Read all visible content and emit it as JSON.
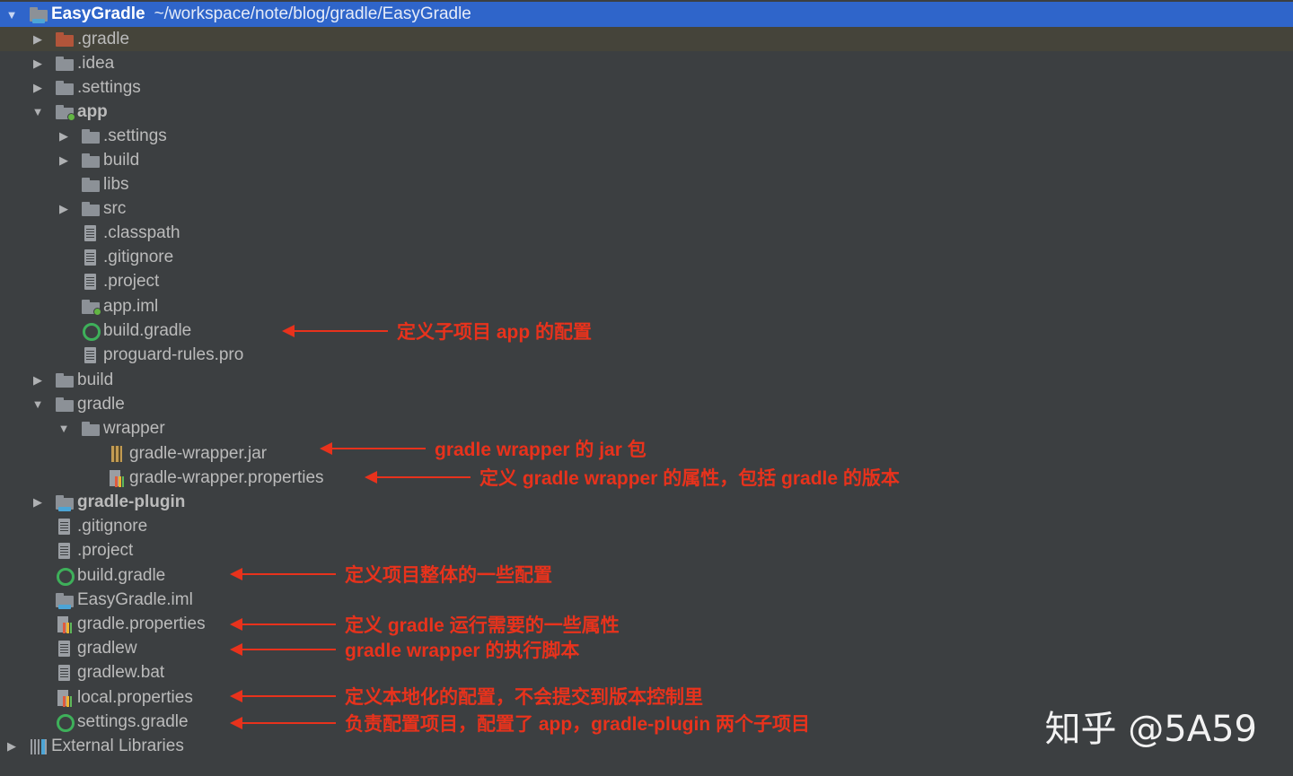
{
  "project": {
    "name": "EasyGradle",
    "path": "~/workspace/note/blog/gradle/EasyGradle"
  },
  "tree": [
    {
      "label": ".gradle",
      "icon": "orange-folder-icon"
    },
    {
      "label": ".idea",
      "icon": "folder-icon"
    },
    {
      "label": ".settings",
      "icon": "folder-icon"
    },
    {
      "label": "app",
      "icon": "module-folder-icon"
    },
    {
      "label": ".settings",
      "icon": "folder-icon"
    },
    {
      "label": "build",
      "icon": "folder-icon"
    },
    {
      "label": "libs",
      "icon": "folder-icon"
    },
    {
      "label": "src",
      "icon": "folder-icon"
    },
    {
      "label": ".classpath",
      "icon": "text-file-icon"
    },
    {
      "label": ".gitignore",
      "icon": "text-file-icon"
    },
    {
      "label": ".project",
      "icon": "text-file-icon"
    },
    {
      "label": "app.iml",
      "icon": "module-file-icon"
    },
    {
      "label": "build.gradle",
      "icon": "gradle-icon"
    },
    {
      "label": "proguard-rules.pro",
      "icon": "text-file-icon"
    },
    {
      "label": "build",
      "icon": "folder-icon"
    },
    {
      "label": "gradle",
      "icon": "folder-icon"
    },
    {
      "label": "wrapper",
      "icon": "folder-icon"
    },
    {
      "label": "gradle-wrapper.jar",
      "icon": "jar-icon"
    },
    {
      "label": "gradle-wrapper.properties",
      "icon": "properties-icon"
    },
    {
      "label": "gradle-plugin",
      "icon": "module-folder-icon"
    },
    {
      "label": ".gitignore",
      "icon": "text-file-icon"
    },
    {
      "label": ".project",
      "icon": "text-file-icon"
    },
    {
      "label": "build.gradle",
      "icon": "gradle-icon"
    },
    {
      "label": "EasyGradle.iml",
      "icon": "module-file-icon"
    },
    {
      "label": "gradle.properties",
      "icon": "properties-icon"
    },
    {
      "label": "gradlew",
      "icon": "text-file-icon"
    },
    {
      "label": "gradlew.bat",
      "icon": "text-file-icon"
    },
    {
      "label": "local.properties",
      "icon": "properties-icon"
    },
    {
      "label": "settings.gradle",
      "icon": "gradle-icon"
    },
    {
      "label": "External Libraries",
      "icon": "libraries-icon"
    }
  ],
  "annotations": [
    "定义子项目 app 的配置",
    "gradle wrapper 的 jar 包",
    "定义 gradle wrapper 的属性，包括 gradle 的版本",
    "定义项目整体的一些配置",
    "定义 gradle 运行需要的一些属性",
    "gradle wrapper 的执行脚本",
    "定义本地化的配置，不会提交到版本控制里",
    "负责配置项目，配置了 app，gradle-plugin 两个子项目"
  ],
  "watermark": "知乎 @5A59",
  "colors": {
    "background": "#3c3f41",
    "selection": "#2f65ca",
    "annotation": "#e8321c",
    "text": "#bbbbbb"
  }
}
